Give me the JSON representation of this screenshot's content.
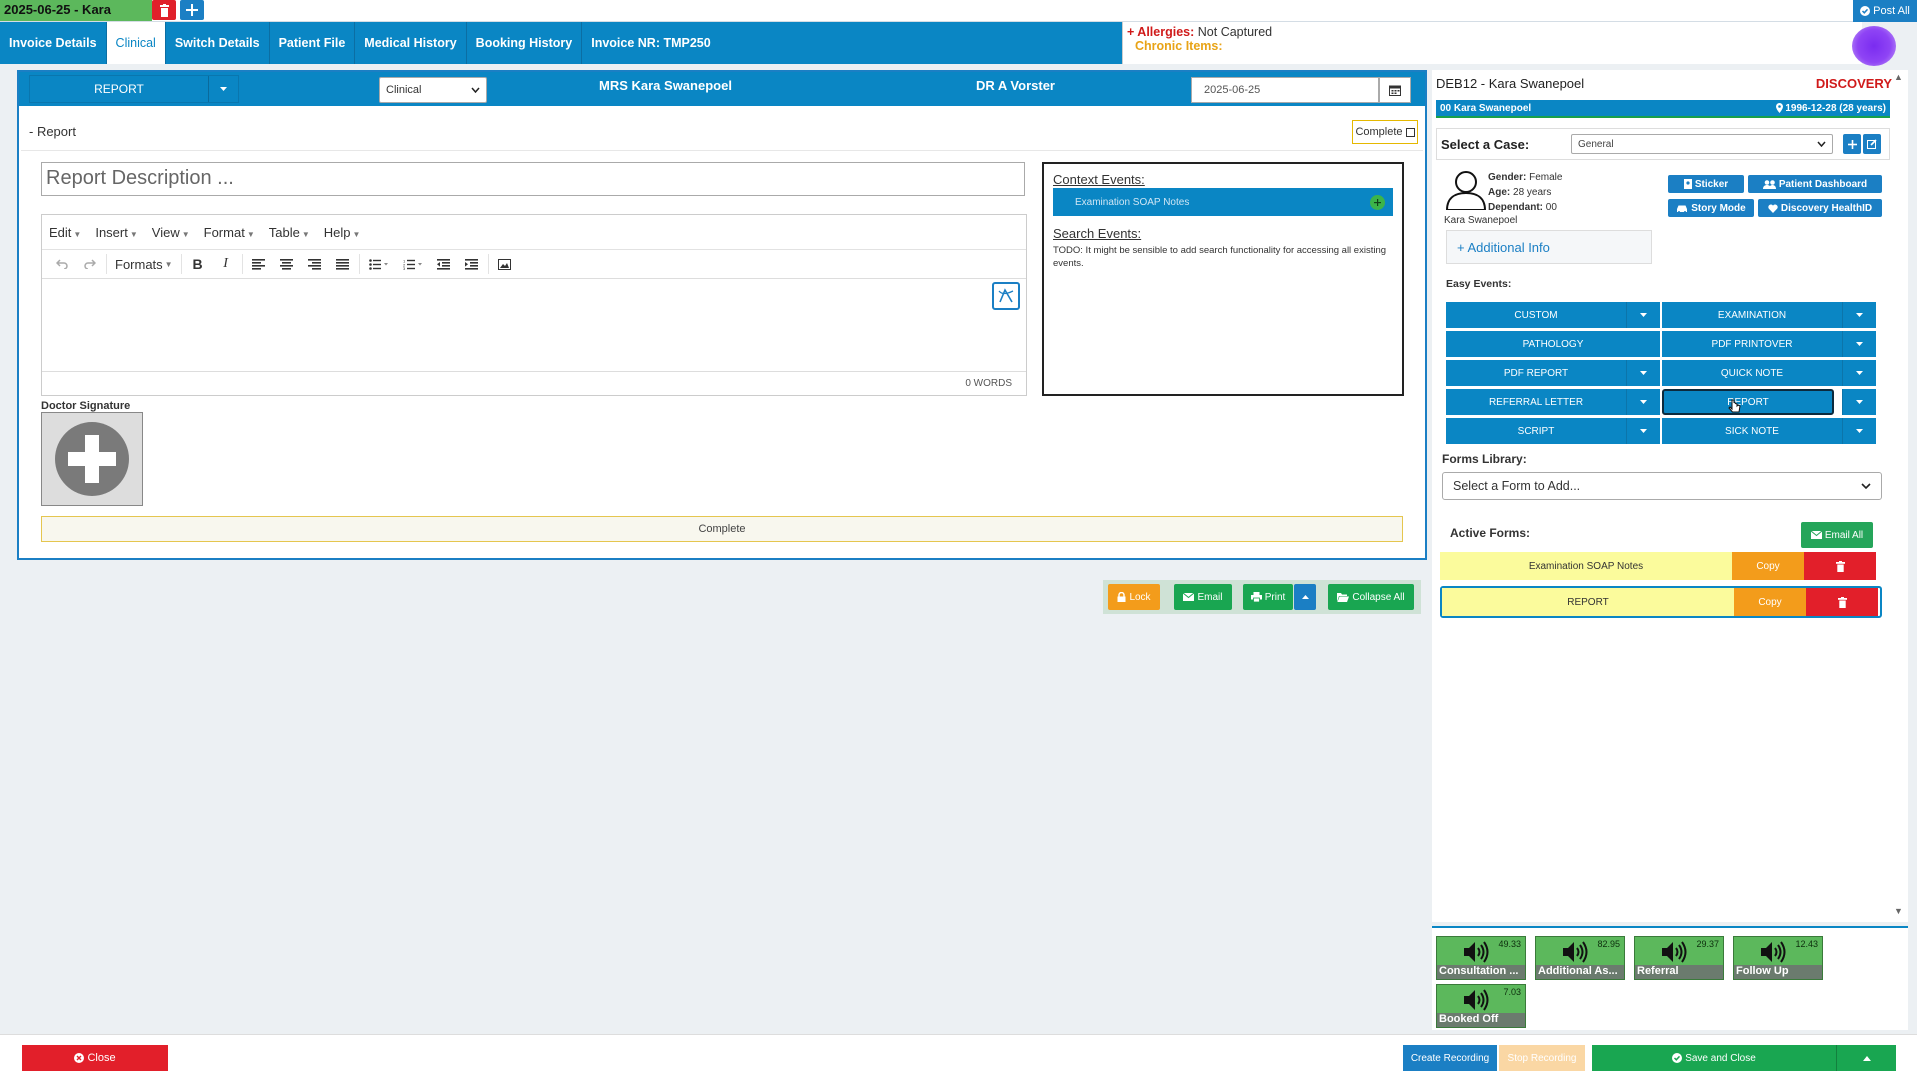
{
  "session": {
    "tab_label": "2025-06-25 - Kara",
    "post_all": "Post All"
  },
  "nav": {
    "tabs": [
      {
        "label": "Invoice Details"
      },
      {
        "label": "Clinical"
      },
      {
        "label": "Switch Details"
      },
      {
        "label": "Patient File"
      },
      {
        "label": "Medical History"
      },
      {
        "label": "Booking History"
      },
      {
        "label": "Invoice NR: TMP250"
      }
    ],
    "allergies_label": "+ Allergies:",
    "allergies_value": "Not Captured",
    "chronic_label": "Chronic Items:"
  },
  "report_panel": {
    "report_button": "REPORT",
    "type_select": "Clinical",
    "patient": "MRS Kara Swanepoel",
    "doctor": "DR A Vorster",
    "date": "2025-06-25",
    "section_label": "- Report",
    "complete_checkbox": "Complete",
    "description_placeholder": "Report Description ...",
    "editor_menu": [
      "Edit",
      "Insert",
      "View",
      "Format",
      "Table",
      "Help"
    ],
    "formats_label": "Formats",
    "word_count": "0 WORDS",
    "signature_label": "Doctor Signature",
    "complete_bar": "Complete"
  },
  "context": {
    "title": "Context Events:",
    "item": "Examination SOAP Notes",
    "search_title": "Search Events:",
    "search_text": "TODO: It might be sensible to add search functionality for accessing all existing events."
  },
  "actions": {
    "lock": "Lock",
    "email": "Email",
    "print": "Print",
    "collapse": "Collapse All"
  },
  "right_panel": {
    "header": "DEB12 - Kara Swanepoel",
    "scheme": "DISCOVERY",
    "bar_left": "00 Kara Swanepoel",
    "bar_right": "1996-12-28 (28 years)",
    "case_label": "Select a Case:",
    "case_value": "General",
    "gender_label": "Gender:",
    "gender": "Female",
    "age_label": "Age:",
    "age": "28 years",
    "dependant_label": "Dependant:",
    "dependant": "00",
    "name_under": "Kara Swanepoel",
    "additional_info": "+ Additional Info",
    "buttons": {
      "sticker": "Sticker",
      "dashboard": "Patient Dashboard",
      "story": "Story Mode",
      "healthid": "Discovery HealthID"
    },
    "easy_events_label": "Easy Events:",
    "easy_events": [
      {
        "label": "CUSTOM",
        "caret": true
      },
      {
        "label": "EXAMINATION",
        "caret": true
      },
      {
        "label": "PATHOLOGY",
        "caret": false
      },
      {
        "label": "PDF PRINTOVER",
        "caret": true
      },
      {
        "label": "PDF REPORT",
        "caret": true
      },
      {
        "label": "QUICK NOTE",
        "caret": true
      },
      {
        "label": "REFERRAL LETTER",
        "caret": true
      },
      {
        "label": "REPORT",
        "caret": true
      },
      {
        "label": "SCRIPT",
        "caret": true
      },
      {
        "label": "SICK NOTE",
        "caret": true
      }
    ],
    "forms_library_label": "Forms Library:",
    "forms_select": "Select a Form to Add...",
    "active_forms_label": "Active Forms:",
    "email_all": "Email All",
    "active_forms": [
      {
        "name": "Examination SOAP Notes",
        "copy": "Copy"
      },
      {
        "name": "REPORT",
        "copy": "Copy"
      }
    ]
  },
  "recordings": [
    {
      "name": "Consultation ...",
      "duration": "49.33"
    },
    {
      "name": "Additional As...",
      "duration": "82.95"
    },
    {
      "name": "Referral",
      "duration": "29.37"
    },
    {
      "name": "Follow Up",
      "duration": "12.43"
    },
    {
      "name": "Booked Off",
      "duration": "7.03"
    }
  ],
  "bottom": {
    "close": "Close",
    "create_recording": "Create Recording",
    "stop_recording": "Stop Recording",
    "save_close": "Save and Close"
  },
  "colors": {
    "primary": "#0a86c4",
    "danger": "#e21f2a",
    "success": "#19a651",
    "warning": "#f39c1b",
    "recording": "#5cb85c"
  }
}
